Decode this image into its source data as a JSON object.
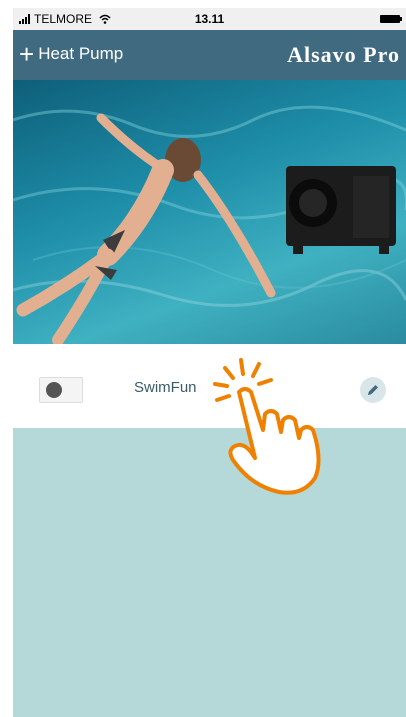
{
  "status_bar": {
    "carrier": "TELMORE",
    "time": "13.11",
    "signal_icon": "signal-icon",
    "wifi_icon": "wifi-icon",
    "battery_icon": "battery-icon"
  },
  "header": {
    "add_label": "Heat Pump",
    "add_icon": "plus-icon",
    "brand": "Alsavo Pro",
    "background": "#3f6a80"
  },
  "device": {
    "name": "SwimFun",
    "status_icon": "device-status-icon",
    "edit_icon": "pencil-icon"
  },
  "colors": {
    "accent": "#3f6a80",
    "background": "#b5d9d8",
    "pointer": "#f08000"
  },
  "overlay": {
    "icon": "tap-hand-icon"
  }
}
